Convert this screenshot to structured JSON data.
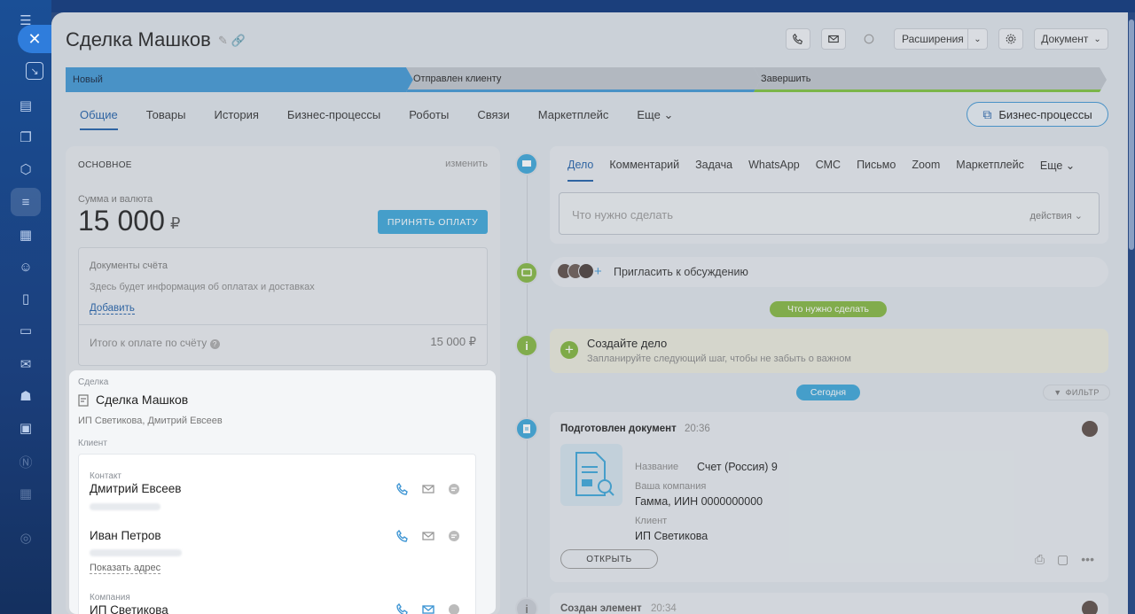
{
  "header": {
    "title": "Сделка Машков",
    "extensions_label": "Расширения",
    "document_label": "Документ"
  },
  "stages": [
    {
      "label": "Новый"
    },
    {
      "label": "Отправлен клиенту"
    },
    {
      "label": "Завершить"
    }
  ],
  "tabs": [
    "Общие",
    "Товары",
    "История",
    "Бизнес-процессы",
    "Роботы",
    "Связи",
    "Маркетплейс",
    "Еще"
  ],
  "bp_button": "Бизнес-процессы",
  "main_section": {
    "heading": "ОСНОВНОЕ",
    "edit": "изменить",
    "sum_label": "Сумма и валюта",
    "sum_value": "15 000",
    "currency": "₽",
    "pay_button": "ПРИНЯТЬ ОПЛАТУ",
    "docs_title": "Документы счёта",
    "docs_info": "Здесь будет информация об оплатах и доставках",
    "docs_add": "Добавить",
    "total_label": "Итого к оплате по счёту",
    "total_value": "15 000 ₽"
  },
  "deal_block": {
    "deal_label": "Сделка",
    "deal_name": "Сделка Машков",
    "companies": "ИП Светикова, Дмитрий Евсеев",
    "client_label": "Клиент",
    "contact_label": "Контакт",
    "contact1": "Дмитрий Евсеев",
    "contact2": "Иван Петров",
    "show_address": "Показать адрес",
    "company_label": "Компания",
    "company_name": "ИП Светикова"
  },
  "activity": {
    "tabs": [
      "Дело",
      "Комментарий",
      "Задача",
      "WhatsApp",
      "СМС",
      "Письмо",
      "Zoom",
      "Маркетплейс",
      "Еще"
    ],
    "placeholder": "Что нужно сделать",
    "actions": "действия"
  },
  "invite": "Пригласить к обсуждению",
  "todo_pill": "Что нужно сделать",
  "todo": {
    "title": "Создайте дело",
    "subtitle": "Запланируйте следующий шаг, чтобы не забыть о важном"
  },
  "today_pill": "Сегодня",
  "filter": "ФИЛЬТР",
  "doc_event": {
    "title": "Подготовлен документ",
    "time": "20:36",
    "name_label": "Название",
    "name_value": "Счет (Россия) 9",
    "company_label": "Ваша компания",
    "company_value": "Гамма, ИИН 0000000000",
    "client_label": "Клиент",
    "client_value": "ИП Светикова",
    "open_button": "ОТКРЫТЬ"
  },
  "created_event": {
    "title": "Создан элемент",
    "time": "20:34"
  },
  "colors": {
    "accent": "#3f96d4",
    "link": "#1f5fa8",
    "green": "#83b63f",
    "pay": "#3aa5d8"
  }
}
